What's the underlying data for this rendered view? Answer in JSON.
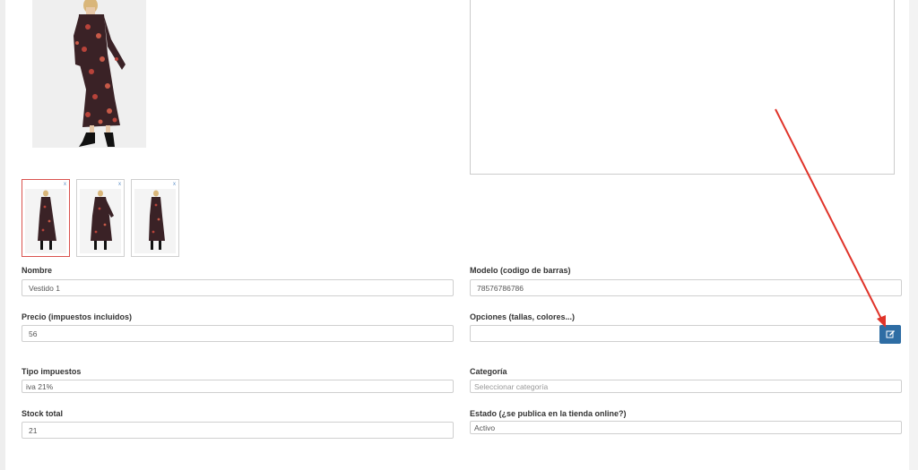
{
  "product": {
    "fields": {
      "nombre": {
        "label": "Nombre",
        "value": "Vestido 1"
      },
      "modelo": {
        "label": "Modelo (codigo de barras)",
        "value": "78576786786"
      },
      "precio": {
        "label": "Precio (impuestos incluidos)",
        "value": "56"
      },
      "opciones": {
        "label": "Opciones (tallas, colores...)",
        "value": ""
      },
      "tipo_impuestos": {
        "label": "Tipo impuestos",
        "value": "iva 21%"
      },
      "categoria": {
        "label": "Categoría",
        "placeholder": "Seleccionar categoría"
      },
      "stock": {
        "label": "Stock total",
        "value": "21"
      },
      "estado": {
        "label": "Estado (¿se publica en la tienda online?)",
        "value": "Activo"
      }
    },
    "thumbnails": [
      {
        "remove": "x"
      },
      {
        "remove": "x"
      },
      {
        "remove": "x"
      }
    ]
  },
  "colors": {
    "primary_button": "#2e6da4",
    "selected_thumb_border": "#d9534f",
    "annotation_arrow": "#e0342a",
    "dress_pattern_bg": "#3a2226",
    "dress_flowers": "#b8433a"
  },
  "icons": {
    "edit": "edit-icon",
    "remove": "close-icon"
  }
}
